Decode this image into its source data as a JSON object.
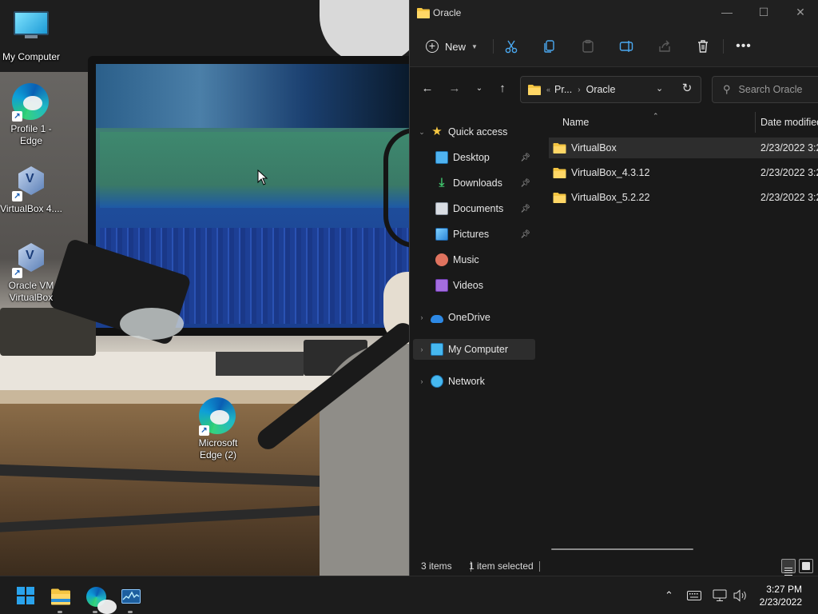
{
  "desktop": {
    "icons": [
      {
        "label_line1": "My Computer",
        "label_line2": ""
      },
      {
        "label_line1": "Profile 1 -",
        "label_line2": "Edge"
      },
      {
        "label_line1": "VirtualBox 4....",
        "label_line2": ""
      },
      {
        "label_line1": "Oracle VM",
        "label_line2": "VirtualBox"
      },
      {
        "label_line1": "Microsoft",
        "label_line2": "Edge (2)"
      }
    ]
  },
  "explorer": {
    "title": "Oracle",
    "window_controls": {
      "minimize": "—",
      "maximize": "☐",
      "close": "✕"
    },
    "commandbar": {
      "new_label": "New",
      "icons": [
        "cut-icon",
        "copy-icon",
        "paste-icon",
        "rename-icon",
        "share-icon",
        "delete-icon",
        "more-icon"
      ]
    },
    "address": {
      "overflow": "«",
      "crumbs": [
        "Pr...",
        "Oracle"
      ],
      "search_placeholder": "Search Oracle"
    },
    "nav": {
      "quick_access": "Quick access",
      "items": [
        {
          "label": "Desktop",
          "pinned": true
        },
        {
          "label": "Downloads",
          "pinned": true
        },
        {
          "label": "Documents",
          "pinned": true
        },
        {
          "label": "Pictures",
          "pinned": true
        },
        {
          "label": "Music",
          "pinned": false
        },
        {
          "label": "Videos",
          "pinned": false
        }
      ],
      "onedrive": "OneDrive",
      "my_computer": "My Computer",
      "network": "Network",
      "selected": "My Computer"
    },
    "columns": {
      "name": "Name",
      "date": "Date modified"
    },
    "files": [
      {
        "name": "VirtualBox",
        "date": "2/23/2022 3:2",
        "selected": true
      },
      {
        "name": "VirtualBox_4.3.12",
        "date": "2/23/2022 3:2",
        "selected": false
      },
      {
        "name": "VirtualBox_5.2.22",
        "date": "2/23/2022 3:2",
        "selected": false
      }
    ],
    "status": {
      "items": "3 items",
      "selection": "1 item selected"
    }
  },
  "taskbar": {
    "apps": [
      "start-icon",
      "file-explorer-icon",
      "edge-icon",
      "task-manager-icon"
    ],
    "time": "3:27 PM",
    "date": "2/23/2022"
  },
  "colors": {
    "accent": "#2aa3ec",
    "window_bg": "#191919",
    "chrome_bg": "#202020",
    "selection_bg": "#2d2d2d",
    "folder": "#f4c542"
  }
}
